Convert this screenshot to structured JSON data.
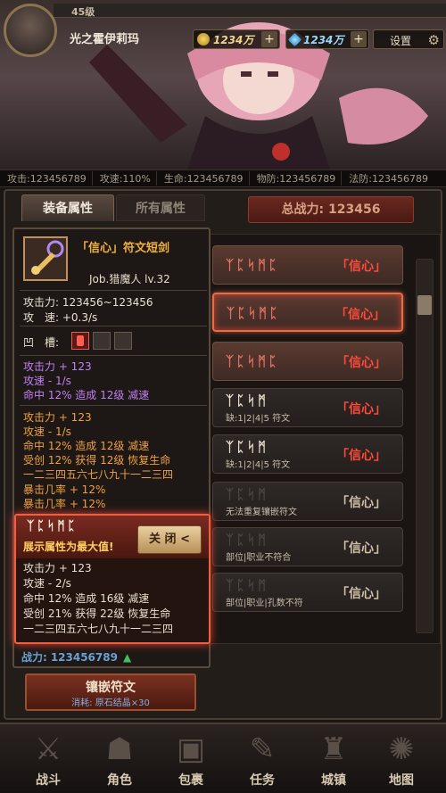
{
  "header": {
    "level": "45级",
    "player_name": "光之霍伊莉玛",
    "gold": "1234万",
    "diamond": "1234万",
    "settings_label": "设置"
  },
  "stats": [
    "攻击:123456789",
    "攻速:110%",
    "生命:123456789",
    "物防:123456789",
    "法防:123456789"
  ],
  "tabs": {
    "equip": "装备属性",
    "all": "所有属性",
    "power": "总战力: 123456"
  },
  "item": {
    "title": "「信心」符文短剑",
    "job": "Job.猎魔人 lv.32",
    "attack": "攻击力: 123456~123456",
    "speed": "攻　速: +0.3/s",
    "sockets_label": "凹　槽:"
  },
  "purple_lines": [
    "攻击力 + 123",
    "攻速 - 1/s",
    "命中 12% 造成 12级 减速"
  ],
  "orange_lines": [
    "攻击力 + 123",
    "攻速 - 1/s",
    "命中 12% 造成 12级 减速",
    "受创 12% 获得 12级 恢复生命",
    "一二三四五六七八九十一二三四",
    "暴击几率 + 12%",
    "暴击几率 + 12%"
  ],
  "highlight": {
    "glyphs": "ᛉᛈᛋᛗᛈ",
    "note": "展示属性为最大值!",
    "close_label": "关 闭 <",
    "lines": [
      "攻击力 + 123",
      "攻速 - 2/s",
      "命中 12% 造成 16级 减速",
      "受创 21% 获得 22级 恢复生命",
      "一二三四五六七八九十一二三四"
    ]
  },
  "power": {
    "label": "战力:",
    "value": "123456789",
    "arrow": "▲"
  },
  "embed": {
    "label": "镶嵌符文",
    "cost": "消耗: 原石结晶×30"
  },
  "rune_list": [
    {
      "glyphs": "ᛉᛈᛋᛗᛈ",
      "name": "「信心」",
      "note": ""
    },
    {
      "glyphs": "ᛉᛈᛋᛗᛈ",
      "name": "「信心」",
      "note": ""
    },
    {
      "glyphs": "ᛉᛈᛋᛗᛈ",
      "name": "「信心」",
      "note": ""
    },
    {
      "glyphs": "ᛉᛈᛋᛗ",
      "name": "「信心」",
      "note": "缺:1|2|4|5 符文"
    },
    {
      "glyphs": "ᛉᛈᛋᛗ",
      "name": "「信心」",
      "note": "缺:1|2|4|5 符文"
    },
    {
      "glyphs": "ᛉᛈᛋᛗ",
      "name": "「信心」",
      "note": "无法重复镶嵌符文"
    },
    {
      "glyphs": "ᛉᛈᛋᛗ",
      "name": "「信心」",
      "note": "部位|职业不符合"
    },
    {
      "glyphs": "ᛉᛈᛋᛗ",
      "name": "「信心」",
      "note": "部位|职业|孔数不符"
    }
  ],
  "nav": [
    "战斗",
    "角色",
    "包裹",
    "任务",
    "城镇",
    "地图"
  ],
  "colors": {
    "rune_red": "#ff4a3a",
    "gold": "#f1d58a",
    "purple": "#c080f0",
    "orange": "#f0a040",
    "highlight_border": "#f06040"
  }
}
